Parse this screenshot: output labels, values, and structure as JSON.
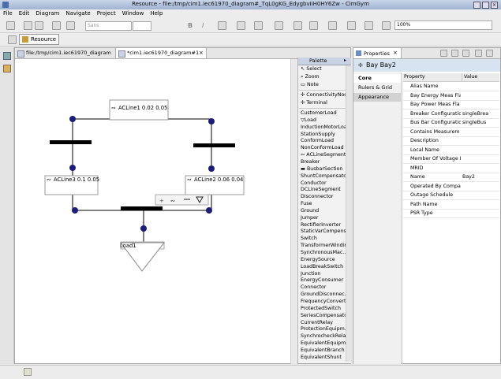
{
  "window": {
    "title": "Resource - file:/tmp/cim1.iec61970_diagram#_TqL0gKG_EdygbvIiH0HY6Zw - CimGym"
  },
  "menu": [
    "File",
    "Edit",
    "Diagram",
    "Navigate",
    "Project",
    "Window",
    "Help"
  ],
  "toolbar": {
    "zoom_value": "100%",
    "font_value": "Sans",
    "perspective_label": "Resource"
  },
  "tabs": [
    {
      "label": "file:/tmp/cim1.iec61970_diagram"
    },
    {
      "label": "*cim1.iec61970_diagram#1"
    }
  ],
  "diagram": {
    "line1": "ACLine1 0.02 0.05",
    "line2": "ACLine2 0.06 0.04",
    "line3": "ACLine3 0.1 0.05",
    "load": "Load1"
  },
  "palette": {
    "title": "Palette",
    "tools": [
      "Select",
      "Zoom",
      "Note"
    ],
    "group": [
      "ConnectivityNode",
      "Terminal"
    ],
    "items": [
      "CustomerLoad",
      "Load",
      "InductionMotorLoad",
      "StationSupply",
      "ConformLoad",
      "NonConformLoad",
      "ACLineSegment",
      "Breaker",
      "BusbarSection",
      "ShuntCompensator",
      "Conductor",
      "DCLineSegment",
      "Disconnector",
      "Fuse",
      "Ground",
      "Jumper",
      "RectifierInverter",
      "StaticVarCompens...",
      "Switch",
      "TransformerWinding",
      "SynchronousMac...",
      "EnergySource",
      "LoadBreakSwitch",
      "Junction",
      "EnergyConsumer",
      "Connector",
      "GroundDisconnec...",
      "FrequencyConverter",
      "ProtectedSwitch",
      "SeriesCompensator",
      "CurrentRelay",
      "ProtectionEquipm...",
      "SynchrocheckRelay",
      "EquivalentEquipm...",
      "EquivalentBranch",
      "EquivalentShunt"
    ]
  },
  "properties": {
    "tab_label": "Properties",
    "title": "Bay Bay2",
    "sections": [
      "Core",
      "Rulers & Grid",
      "Appearance"
    ],
    "col_property": "Property",
    "col_value": "Value",
    "rows": [
      {
        "name": "Alias Name",
        "value": ""
      },
      {
        "name": "Bay Energy Meas Fla",
        "value": ""
      },
      {
        "name": "Bay Power Meas Fla",
        "value": ""
      },
      {
        "name": "Breaker Configuratio",
        "value": "singleBrea"
      },
      {
        "name": "Bus Bar Configuratio",
        "value": "singleBus"
      },
      {
        "name": "Contains Measurem",
        "value": ""
      },
      {
        "name": "Description",
        "value": ""
      },
      {
        "name": "Local Name",
        "value": ""
      },
      {
        "name": "Member Of Voltage I",
        "value": ""
      },
      {
        "name": "MRID",
        "value": ""
      },
      {
        "name": "Name",
        "value": "Bay2"
      },
      {
        "name": "Operated By Compa",
        "value": ""
      },
      {
        "name": "Outage Schedule",
        "value": ""
      },
      {
        "name": "Path Name",
        "value": ""
      },
      {
        "name": "PSR Type",
        "value": ""
      }
    ]
  }
}
